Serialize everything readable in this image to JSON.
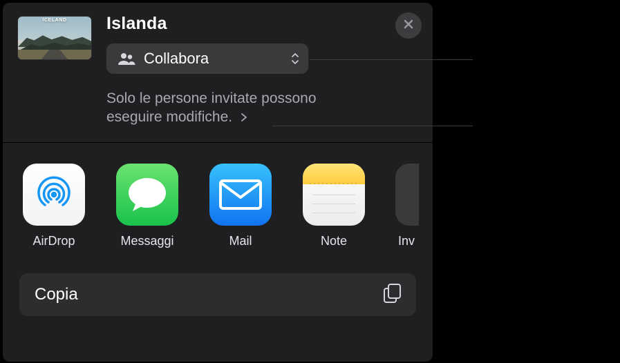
{
  "header": {
    "title": "Islanda",
    "thumb_badge": "ICELAND",
    "close_icon_name": "close-icon"
  },
  "collab": {
    "label": "Collabora",
    "icon_name": "people-icon",
    "chevron_name": "chevron-up-down-icon"
  },
  "permission": {
    "text": "Solo le persone invitate possono eseguire modifiche.",
    "chevron_name": "chevron-right-icon"
  },
  "apps": [
    {
      "id": "airdrop",
      "label": "AirDrop",
      "icon_name": "airdrop-icon"
    },
    {
      "id": "messaggi",
      "label": "Messaggi",
      "icon_name": "messages-icon"
    },
    {
      "id": "mail",
      "label": "Mail",
      "icon_name": "mail-icon"
    },
    {
      "id": "note",
      "label": "Note",
      "icon_name": "notes-icon"
    },
    {
      "id": "invita",
      "label": "Inv",
      "icon_name": "share-icon"
    }
  ],
  "actions": {
    "copy_label": "Copia",
    "copy_icon_name": "copy-icon"
  },
  "colors": {
    "panel_bg": "#1f1f21",
    "control_bg": "#3a3a3c",
    "primary_text": "#ffffff",
    "secondary_text": "#a9a9ae"
  }
}
